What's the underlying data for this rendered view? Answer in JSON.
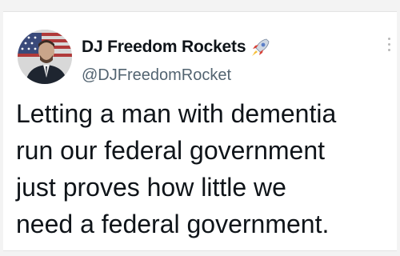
{
  "tweet": {
    "display_name": "DJ Freedom Rockets",
    "handle": "@DJFreedomRocket",
    "text": "Letting a man with dementia\nrun our federal government\njust proves how little we\nneed a federal government.",
    "name_emoji_icon": "rocket-icon",
    "menu_icon": "more-options-icon"
  },
  "colors": {
    "text": "#0f1419",
    "handle": "#536471",
    "background": "#ffffff"
  }
}
